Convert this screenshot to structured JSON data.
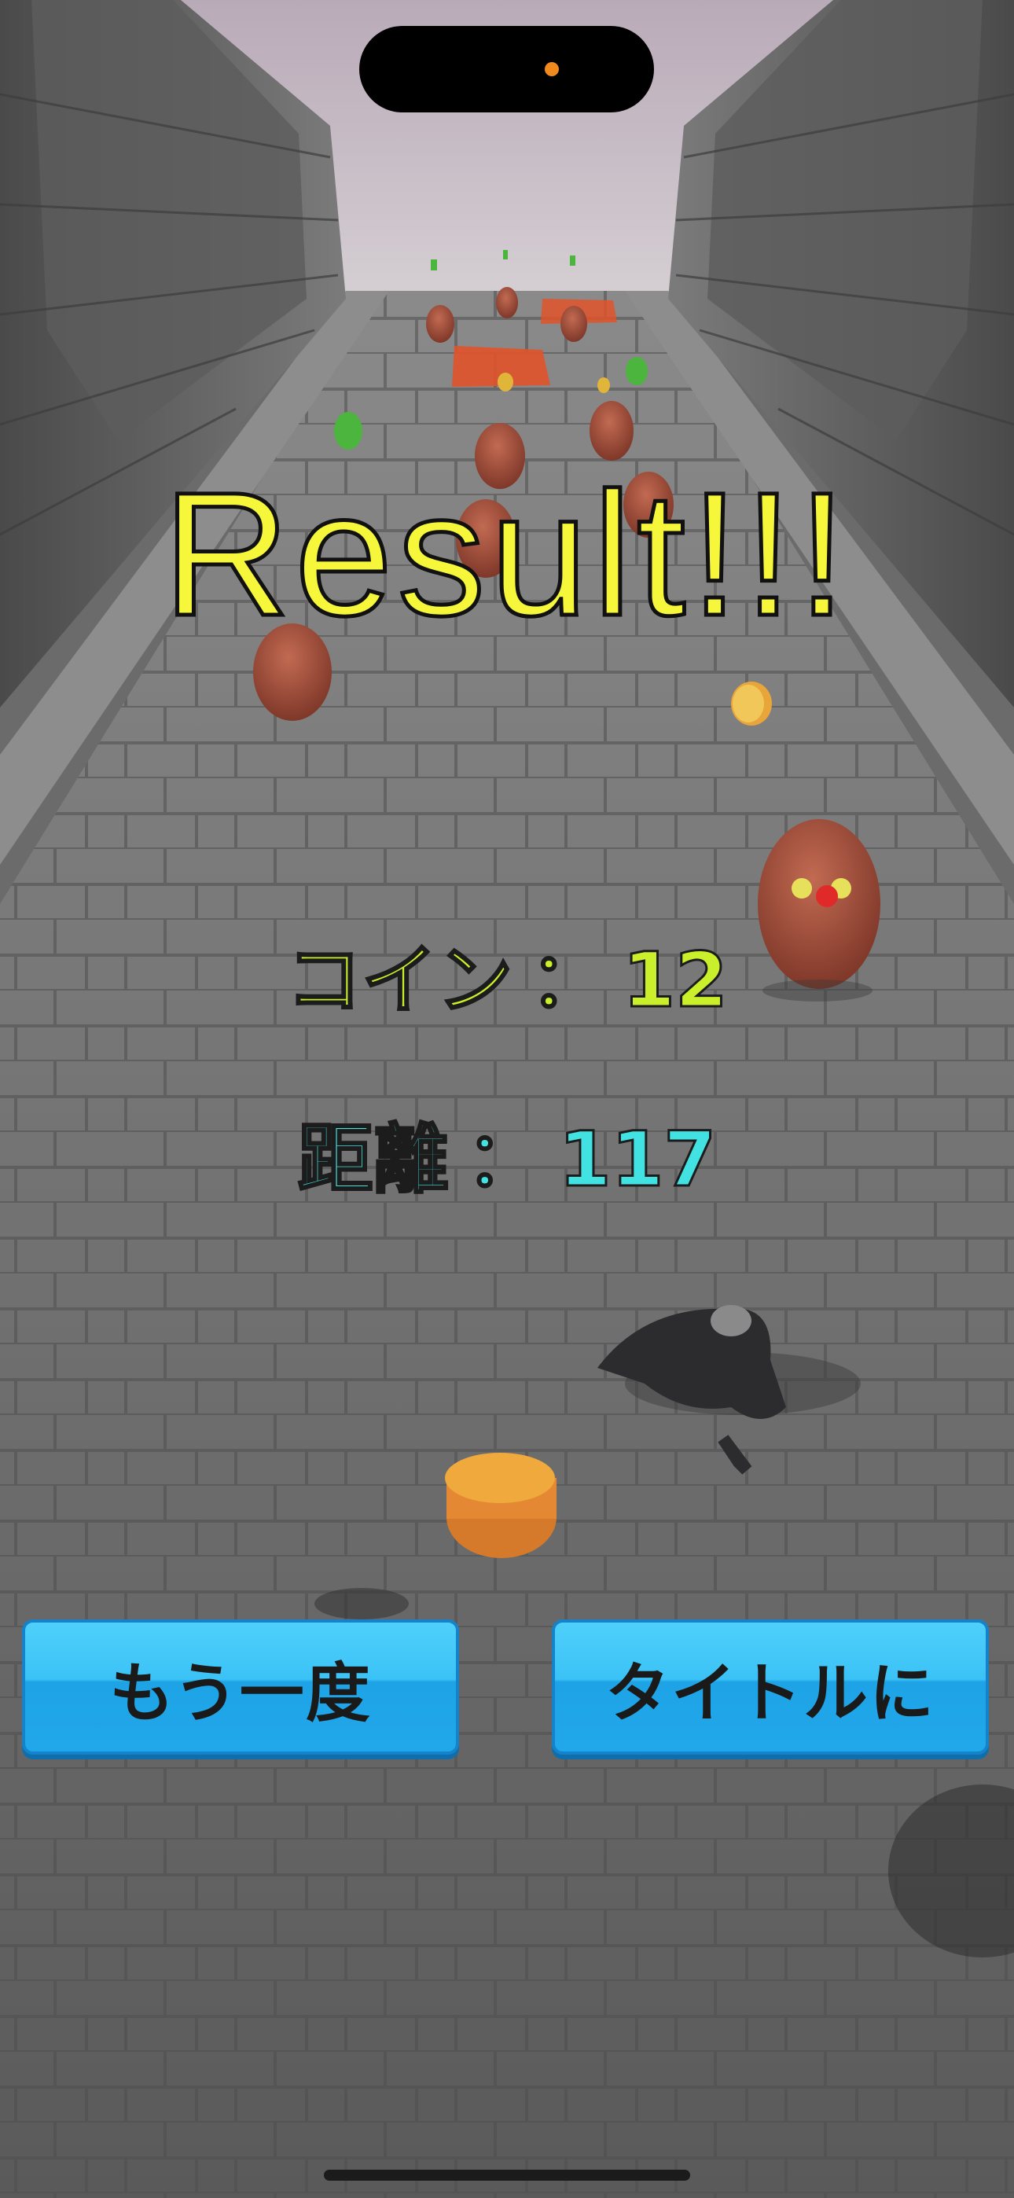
{
  "result_title": "Result!!!",
  "stats": {
    "coin_label": "コイン",
    "coin_separator": "：",
    "coin_value": "12",
    "distance_label": "距離",
    "distance_separator": "：",
    "distance_value": "117"
  },
  "buttons": {
    "retry_label": "もう一度",
    "title_label": "タイトルに"
  },
  "colors": {
    "title_text": "#f6f63a",
    "coin_text": "#c9f02a",
    "distance_text": "#43e2e2",
    "button_fill": "#3bc2f6",
    "status_dot": "#f08a1c"
  }
}
